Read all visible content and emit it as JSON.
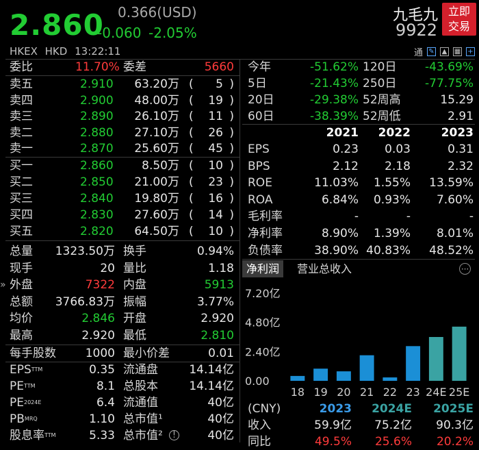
{
  "quote": {
    "price": "2.860",
    "ref_price": "0.366(USD)",
    "change": "-0.060",
    "change_pct": "-2.05%",
    "name": "九毛九",
    "code": "9922",
    "trade_button": "立即交易",
    "trade_button_l1": "立即",
    "trade_button_l2": "交易",
    "exchange": "HKEX",
    "currency": "HKD",
    "time": "13:22:11",
    "tool_label": "通"
  },
  "commission": {
    "ratio_label": "委比",
    "ratio_value": "11.70%",
    "diff_label": "委差",
    "diff_value": "5660"
  },
  "asks": [
    {
      "label": "卖五",
      "price": "2.910",
      "volume": "63.20万",
      "orders": "5"
    },
    {
      "label": "卖四",
      "price": "2.900",
      "volume": "48.00万",
      "orders": "19"
    },
    {
      "label": "卖三",
      "price": "2.890",
      "volume": "26.10万",
      "orders": "11"
    },
    {
      "label": "卖二",
      "price": "2.880",
      "volume": "27.10万",
      "orders": "26"
    },
    {
      "label": "卖一",
      "price": "2.870",
      "volume": "25.60万",
      "orders": "45"
    }
  ],
  "bids": [
    {
      "label": "买一",
      "price": "2.860",
      "volume": "8.50万",
      "orders": "10"
    },
    {
      "label": "买二",
      "price": "2.850",
      "volume": "21.00万",
      "orders": "23"
    },
    {
      "label": "买三",
      "price": "2.840",
      "volume": "19.80万",
      "orders": "16"
    },
    {
      "label": "买四",
      "price": "2.830",
      "volume": "27.60万",
      "orders": "14"
    },
    {
      "label": "买五",
      "price": "2.820",
      "volume": "64.50万",
      "orders": "10"
    }
  ],
  "stats": [
    {
      "l1": "总量",
      "v1": "1323.50万",
      "c1": "white",
      "l2": "换手",
      "v2": "0.94%",
      "c2": "white"
    },
    {
      "l1": "现手",
      "v1": "20",
      "c1": "white",
      "l2": "量比",
      "v2": "1.18",
      "c2": "white"
    },
    {
      "l1": "外盘",
      "v1": "7322",
      "c1": "up",
      "l2": "内盘",
      "v2": "5913",
      "c2": "down"
    },
    {
      "l1": "总额",
      "v1": "3766.83万",
      "c1": "white",
      "l2": "振幅",
      "v2": "3.77%",
      "c2": "white"
    },
    {
      "l1": "均价",
      "v1": "2.846",
      "c1": "down",
      "l2": "开盘",
      "v2": "2.920",
      "c2": "white"
    },
    {
      "l1": "最高",
      "v1": "2.920",
      "c1": "white",
      "l2": "最低",
      "v2": "2.810",
      "c2": "down"
    }
  ],
  "lot": {
    "l1": "每手股数",
    "v1": "1000",
    "l2": "最小价差",
    "v2": "0.01"
  },
  "valuation": [
    {
      "l1": "EPS",
      "sup": "TTM",
      "v1": "0.35",
      "l2": "流通盘",
      "v2": "14.14亿"
    },
    {
      "l1": "PE",
      "sup": "TTM",
      "v1": "8.1",
      "l2": "总股本",
      "v2": "14.14亿"
    },
    {
      "l1": "PE",
      "sup": "2024E",
      "v1": "6.4",
      "l2": "流通值",
      "v2": "40亿"
    },
    {
      "l1": "PB",
      "sup": "MRQ",
      "v1": "1.10",
      "l2": "总市值¹",
      "v2": "40亿"
    },
    {
      "l1": "股息率",
      "sup": "TTM",
      "v1": "5.33",
      "l2": "总市值²",
      "v2": "40亿"
    }
  ],
  "period_returns": [
    {
      "l1": "今年",
      "v1": "-51.62%",
      "l2": "120日",
      "v2": "-43.69%",
      "c2": "down"
    },
    {
      "l1": "5日",
      "v1": "-21.43%",
      "l2": "250日",
      "v2": "-77.75%",
      "c2": "down"
    },
    {
      "l1": "20日",
      "v1": "-29.38%",
      "l2": "52周高",
      "v2": "15.29",
      "c2": "white"
    },
    {
      "l1": "60日",
      "v1": "-38.39%",
      "l2": "52周低",
      "v2": "2.91",
      "c2": "white"
    }
  ],
  "fin_years": [
    "2021",
    "2022",
    "2023"
  ],
  "fin_rows": [
    {
      "label": "EPS",
      "vals": [
        "0.23",
        "0.03",
        "0.31"
      ]
    },
    {
      "label": "BPS",
      "vals": [
        "2.12",
        "2.18",
        "2.32"
      ]
    },
    {
      "label": "ROE",
      "vals": [
        "11.03%",
        "1.55%",
        "13.59%"
      ]
    },
    {
      "label": "ROA",
      "vals": [
        "6.84%",
        "0.93%",
        "7.60%"
      ]
    },
    {
      "label": "毛利率",
      "vals": [
        "-",
        "-",
        "-"
      ]
    },
    {
      "label": "净利率",
      "vals": [
        "8.90%",
        "1.39%",
        "8.01%"
      ]
    },
    {
      "label": "负债率",
      "vals": [
        "38.90%",
        "40.83%",
        "48.52%"
      ]
    }
  ],
  "tabs": [
    "净利润",
    "营业总收入"
  ],
  "chart_data": {
    "type": "bar",
    "categories": [
      "18",
      "19",
      "20",
      "21",
      "22",
      "23",
      "24E",
      "25E"
    ],
    "values": [
      0.4,
      1.0,
      0.78,
      2.1,
      0.28,
      2.85,
      3.6,
      4.45
    ],
    "forecast": [
      false,
      false,
      false,
      false,
      false,
      false,
      true,
      true
    ],
    "yticks": [
      "7.20亿",
      "4.80亿",
      "2.40亿",
      "0.00"
    ],
    "ylim": [
      0,
      4.8
    ],
    "colors": {
      "actual": "#1b8fd6",
      "forecast": "#3aa3a3"
    }
  },
  "revenue": {
    "currency": "(CNY)",
    "years": [
      "2023",
      "2024E",
      "2025E"
    ],
    "rows": [
      {
        "label": "收入",
        "vals": [
          "59.9亿",
          "75.2亿",
          "90.3亿"
        ]
      },
      {
        "label": "同比",
        "vals": [
          "49.5%",
          "25.6%",
          "20.2%"
        ]
      }
    ]
  }
}
